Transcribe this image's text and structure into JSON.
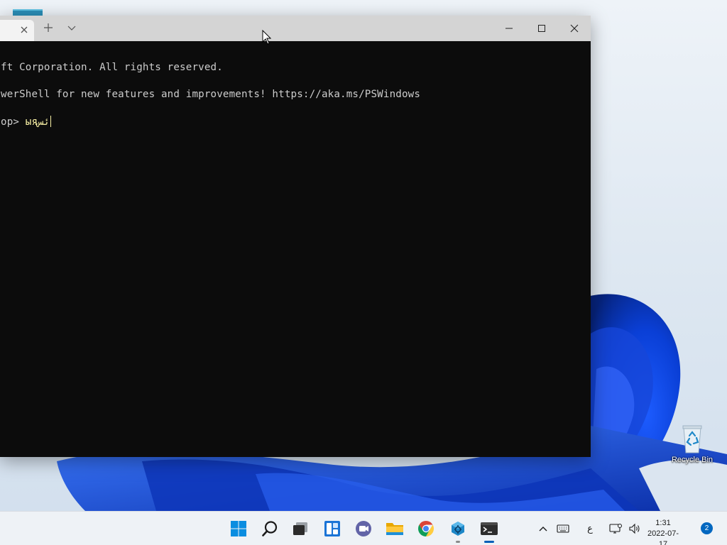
{
  "desktop": {
    "recycle_bin_label": "Recycle Bin"
  },
  "terminal": {
    "tab_close_icon": "close-icon",
    "new_tab_icon": "plus-icon",
    "dropdown_icon": "chevron-down-icon",
    "window_buttons": [
      "minimize-icon",
      "maximize-icon",
      "close-icon"
    ],
    "lines": [
      "ft Corporation. All rights reserved.",
      "werShell for new features and improvements! https://aka.ms/PSWindows"
    ],
    "prompt": "op> ",
    "typed_input": "ыяئس",
    "text_color": "#cccccc",
    "input_color": "#f9f1a5",
    "background": "#0c0c0c"
  },
  "taskbar": {
    "apps": [
      {
        "name": "start",
        "icon": "windows-logo-icon"
      },
      {
        "name": "search",
        "icon": "search-icon"
      },
      {
        "name": "task-view",
        "icon": "task-view-icon"
      },
      {
        "name": "widgets",
        "icon": "widgets-icon"
      },
      {
        "name": "teams-chat",
        "icon": "chat-icon"
      },
      {
        "name": "file-explorer",
        "icon": "folder-icon"
      },
      {
        "name": "chrome",
        "icon": "chrome-icon"
      },
      {
        "name": "app",
        "icon": "gear-box-icon",
        "state": "open"
      },
      {
        "name": "terminal",
        "icon": "terminal-icon",
        "state": "active"
      }
    ],
    "tray": {
      "ime_mode": "ع",
      "time": "1:31",
      "date": "2022-07-17",
      "notification_count": "2"
    },
    "accent_color": "#005fb8"
  }
}
